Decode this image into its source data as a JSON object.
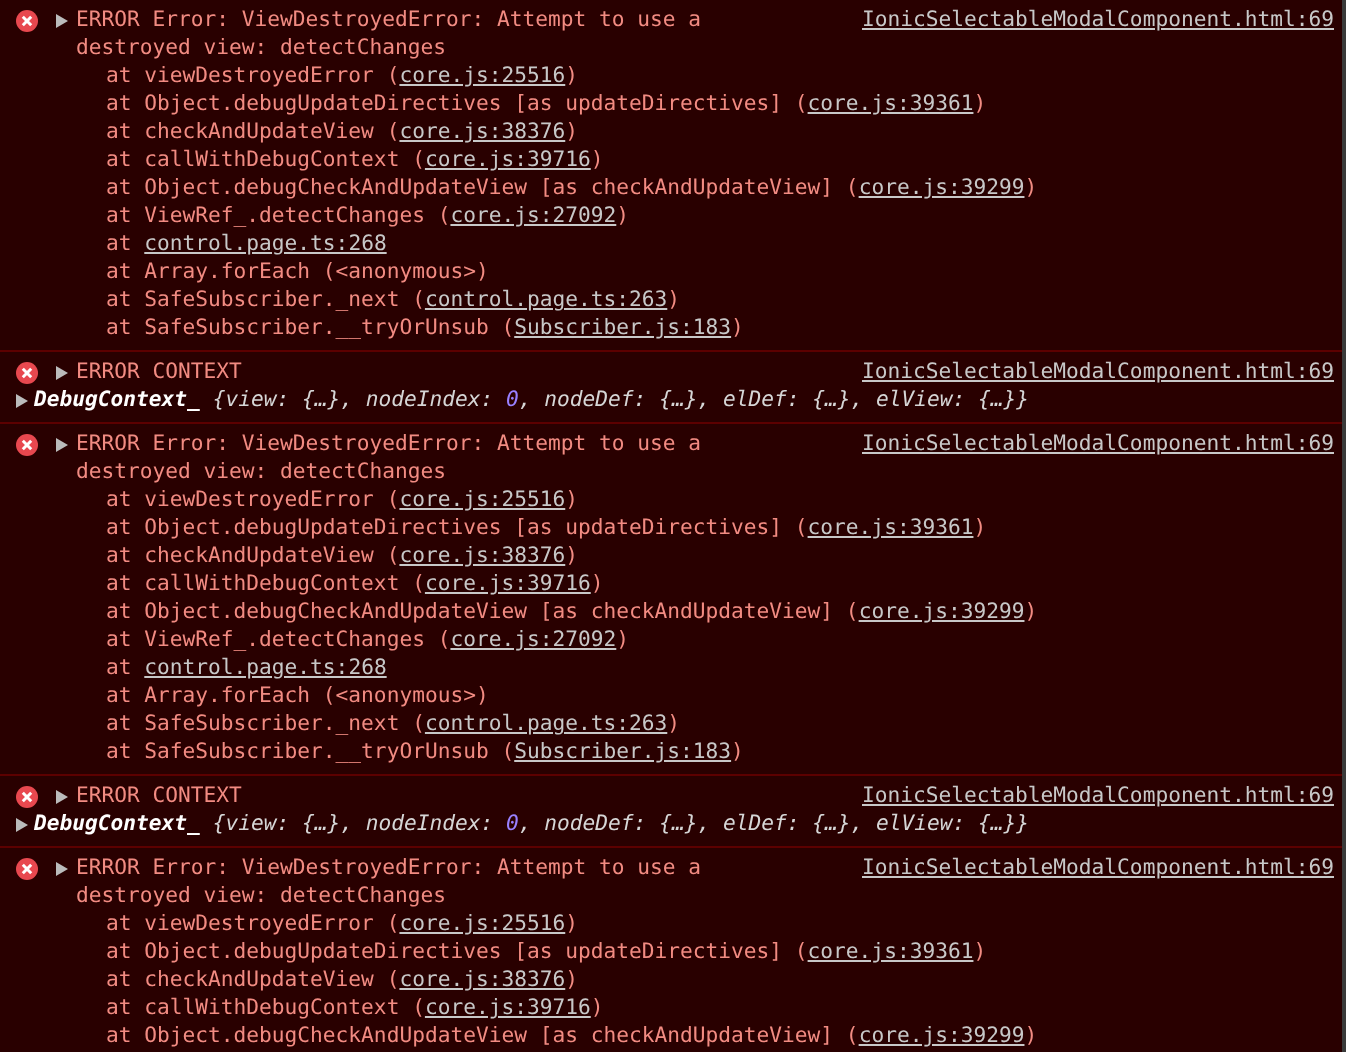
{
  "console_messages": [
    {
      "kind": "error",
      "message": "ERROR Error: ViewDestroyedError: Attempt to use a destroyed view: detectChanges",
      "source": "IonicSelectableModalComponent.html:69",
      "stack": [
        {
          "before": "at viewDestroyedError (",
          "link": "core.js:25516",
          "after": ")"
        },
        {
          "before": "at Object.debugUpdateDirectives [as updateDirectives] (",
          "link": "core.js:39361",
          "after": ")"
        },
        {
          "before": "at checkAndUpdateView (",
          "link": "core.js:38376",
          "after": ")"
        },
        {
          "before": "at callWithDebugContext (",
          "link": "core.js:39716",
          "after": ")"
        },
        {
          "before": "at Object.debugCheckAndUpdateView [as checkAndUpdateView] (",
          "link": "core.js:39299",
          "after": ")"
        },
        {
          "before": "at ViewRef_.detectChanges (",
          "link": "core.js:27092",
          "after": ")"
        },
        {
          "before": "at ",
          "link": "control.page.ts:268"
        },
        {
          "before": "at Array.forEach (<anonymous>)"
        },
        {
          "before": "at SafeSubscriber._next (",
          "link": "control.page.ts:263",
          "after": ")"
        },
        {
          "before": "at SafeSubscriber.__tryOrUnsub (",
          "link": "Subscriber.js:183",
          "after": ")"
        }
      ]
    },
    {
      "kind": "context",
      "message": "ERROR CONTEXT",
      "source": "IonicSelectableModalComponent.html:69",
      "object": "DebugContext_",
      "preview": [
        {
          "kind": "plain",
          "text": "{view: {…}, nodeIndex: "
        },
        {
          "kind": "number",
          "text": "0"
        },
        {
          "kind": "plain",
          "text": ", nodeDef: {…}, elDef: {…}, elView: {…}}"
        }
      ]
    },
    {
      "kind": "error",
      "message": "ERROR Error: ViewDestroyedError: Attempt to use a destroyed view: detectChanges",
      "source": "IonicSelectableModalComponent.html:69",
      "stack": [
        {
          "before": "at viewDestroyedError (",
          "link": "core.js:25516",
          "after": ")"
        },
        {
          "before": "at Object.debugUpdateDirectives [as updateDirectives] (",
          "link": "core.js:39361",
          "after": ")"
        },
        {
          "before": "at checkAndUpdateView (",
          "link": "core.js:38376",
          "after": ")"
        },
        {
          "before": "at callWithDebugContext (",
          "link": "core.js:39716",
          "after": ")"
        },
        {
          "before": "at Object.debugCheckAndUpdateView [as checkAndUpdateView] (",
          "link": "core.js:39299",
          "after": ")"
        },
        {
          "before": "at ViewRef_.detectChanges (",
          "link": "core.js:27092",
          "after": ")"
        },
        {
          "before": "at ",
          "link": "control.page.ts:268"
        },
        {
          "before": "at Array.forEach (<anonymous>)"
        },
        {
          "before": "at SafeSubscriber._next (",
          "link": "control.page.ts:263",
          "after": ")"
        },
        {
          "before": "at SafeSubscriber.__tryOrUnsub (",
          "link": "Subscriber.js:183",
          "after": ")"
        }
      ]
    },
    {
      "kind": "context",
      "message": "ERROR CONTEXT",
      "source": "IonicSelectableModalComponent.html:69",
      "object": "DebugContext_",
      "preview": [
        {
          "kind": "plain",
          "text": "{view: {…}, nodeIndex: "
        },
        {
          "kind": "number",
          "text": "0"
        },
        {
          "kind": "plain",
          "text": ", nodeDef: {…}, elDef: {…}, elView: {…}}"
        }
      ]
    },
    {
      "kind": "error",
      "message": "ERROR Error: ViewDestroyedError: Attempt to use a destroyed view: detectChanges",
      "source": "IonicSelectableModalComponent.html:69",
      "stack": [
        {
          "before": "at viewDestroyedError (",
          "link": "core.js:25516",
          "after": ")"
        },
        {
          "before": "at Object.debugUpdateDirectives [as updateDirectives] (",
          "link": "core.js:39361",
          "after": ")"
        },
        {
          "before": "at checkAndUpdateView (",
          "link": "core.js:38376",
          "after": ")"
        },
        {
          "before": "at callWithDebugContext (",
          "link": "core.js:39716",
          "after": ")"
        },
        {
          "before": "at Object.debugCheckAndUpdateView [as checkAndUpdateView] (",
          "link": "core.js:39299",
          "after": ")"
        }
      ]
    }
  ]
}
